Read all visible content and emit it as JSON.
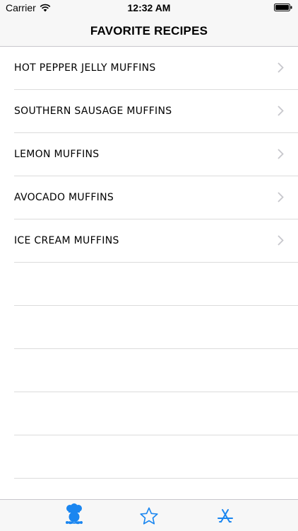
{
  "status_bar": {
    "carrier": "Carrier",
    "time": "12:32 AM",
    "wifi_icon": "wifi-icon",
    "battery_icon": "battery-icon"
  },
  "nav": {
    "title": "FAVORITE RECIPES"
  },
  "recipes": [
    {
      "label": "HOT PEPPER JELLY MUFFINS"
    },
    {
      "label": "SOUTHERN SAUSAGE MUFFINS"
    },
    {
      "label": "LEMON MUFFINS"
    },
    {
      "label": "AVOCADO MUFFINS"
    },
    {
      "label": "ICE CREAM MUFFINS"
    }
  ],
  "empty_rows": 5,
  "tab_bar": {
    "tabs": [
      {
        "icon": "chef-icon",
        "selected": true
      },
      {
        "icon": "star-icon",
        "selected": false
      },
      {
        "icon": "app-store-icon",
        "selected": false
      }
    ]
  },
  "colors": {
    "accent": "#1a86f0",
    "chevron": "#c7c7cc",
    "separator": "#dcdcdc",
    "bar_background": "#f7f7f7"
  }
}
